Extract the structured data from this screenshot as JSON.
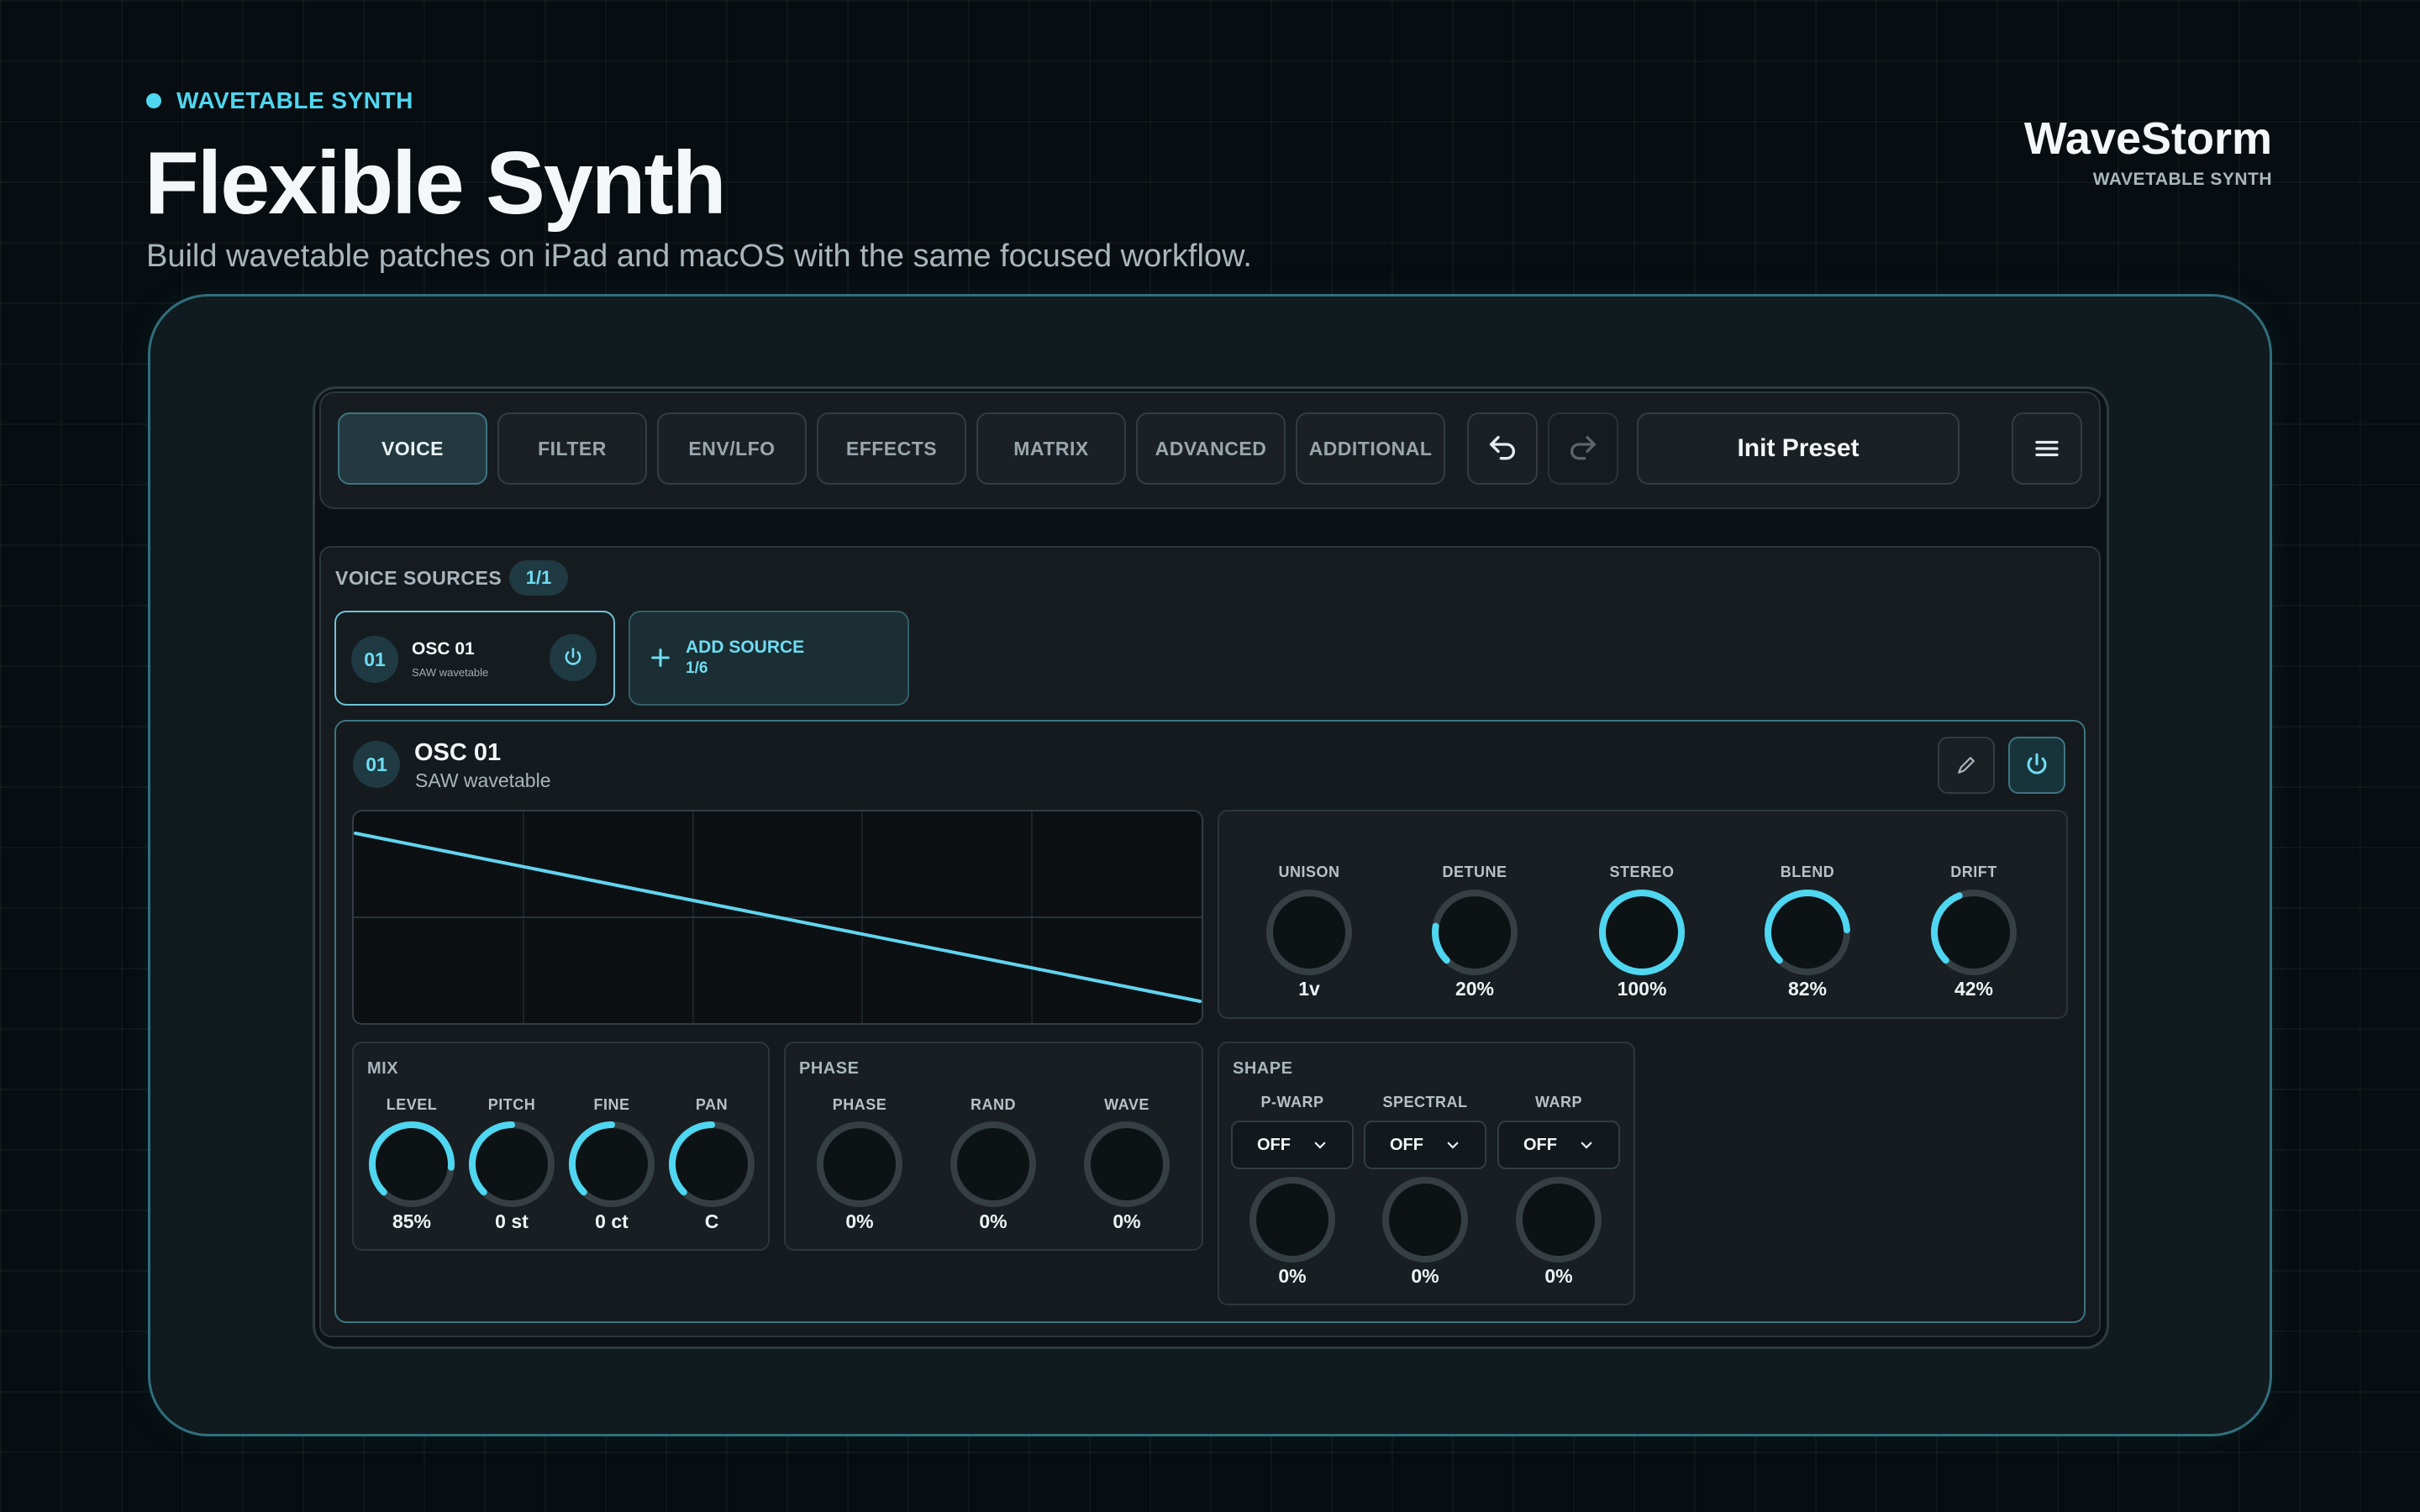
{
  "hero": {
    "eyebrow": "WAVETABLE SYNTH",
    "title": "Flexible Synth",
    "subtitle": "Build wavetable patches on iPad and macOS with the same focused workflow."
  },
  "brand": {
    "name": "WaveStorm",
    "tagline": "WAVETABLE SYNTH"
  },
  "colors": {
    "accent": "#4fd6f0",
    "background": "#070d10",
    "frame": "#2f6f7c"
  },
  "toolbar": {
    "tabs": [
      {
        "label": "VOICE",
        "active": true
      },
      {
        "label": "FILTER"
      },
      {
        "label": "ENV/LFO"
      },
      {
        "label": "EFFECTS"
      },
      {
        "label": "MATRIX"
      },
      {
        "label": "ADVANCED"
      },
      {
        "label": "ADDITIONAL"
      }
    ],
    "undo_icon": "undo-icon",
    "redo_icon": "redo-icon",
    "preset_name": "Init Preset",
    "menu_icon": "hamburger-menu-icon"
  },
  "voice_sources": {
    "label": "VOICE SOURCES",
    "count": "1/1",
    "sources": [
      {
        "number": "01",
        "title": "OSC 01",
        "subtitle": "SAW wavetable",
        "enabled": true
      }
    ],
    "add": {
      "label": "ADD SOURCE",
      "count": "1/6"
    }
  },
  "oscillator": {
    "number": "01",
    "title": "OSC 01",
    "subtitle": "SAW wavetable",
    "waveform": "saw",
    "voice_knobs": [
      {
        "label": "UNISON",
        "value": "1v",
        "level": 0
      },
      {
        "label": "DETUNE",
        "value": "20%",
        "level": 0.2
      },
      {
        "label": "STEREO",
        "value": "100%",
        "level": 1.0
      },
      {
        "label": "BLEND",
        "value": "82%",
        "level": 0.82
      },
      {
        "label": "DRIFT",
        "value": "42%",
        "level": 0.42
      }
    ],
    "mix": {
      "title": "MIX",
      "knobs": [
        {
          "label": "LEVEL",
          "value": "85%",
          "level": 0.85
        },
        {
          "label": "PITCH",
          "value": "0 st",
          "level": 0.5
        },
        {
          "label": "FINE",
          "value": "0 ct",
          "level": 0.5
        },
        {
          "label": "PAN",
          "value": "C",
          "level": 0.5
        }
      ]
    },
    "phase": {
      "title": "PHASE",
      "knobs": [
        {
          "label": "PHASE",
          "value": "0%",
          "level": 0
        },
        {
          "label": "RAND",
          "value": "0%",
          "level": 0
        },
        {
          "label": "WAVE",
          "value": "0%",
          "level": 0
        }
      ]
    },
    "shape": {
      "title": "SHAPE",
      "controls": [
        {
          "label": "P-WARP",
          "mode": "OFF",
          "value": "0%",
          "level": 0
        },
        {
          "label": "SPECTRAL",
          "mode": "OFF",
          "value": "0%",
          "level": 0
        },
        {
          "label": "WARP",
          "mode": "OFF",
          "value": "0%",
          "level": 0
        }
      ]
    }
  }
}
